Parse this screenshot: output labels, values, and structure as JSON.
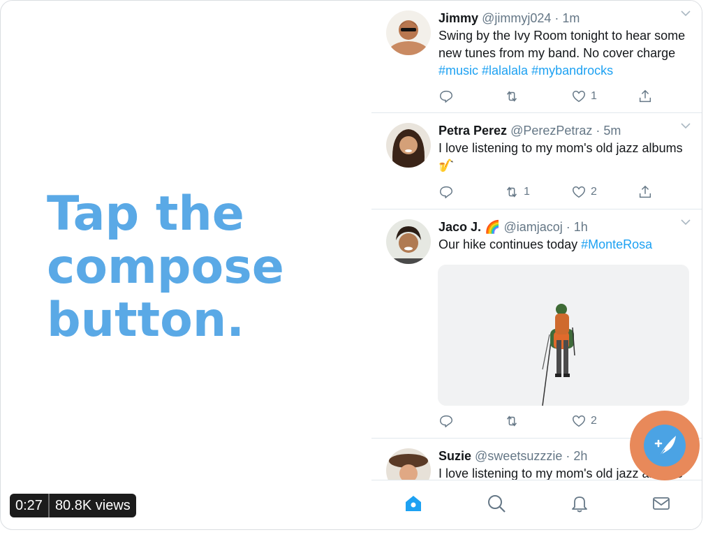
{
  "video": {
    "time": "0:27",
    "views": "80.8K views"
  },
  "headline": {
    "line1": "Tap the",
    "line2": "compose",
    "line3": "button."
  },
  "tweets": [
    {
      "name": "Jimmy",
      "meta": "@jimmyj024 · 1m",
      "text": "Swing by the Ivy Room tonight to hear some new tunes from my band. No cover charge ",
      "hashtags": "#music #lalalala #mybandrocks",
      "counts": {
        "reply": "",
        "retweet": "",
        "like": "1"
      }
    },
    {
      "name": "Petra Perez",
      "meta": "@PerezPetraz · 5m",
      "text": "I love listening to my mom's old jazz albums 🎷",
      "hashtags": "",
      "counts": {
        "reply": "",
        "retweet": "1",
        "like": "2"
      }
    },
    {
      "name": "Jaco J. 🌈",
      "meta": "@iamjacoj · 1h",
      "text": "Our hike continues today ",
      "hashtags": "#MonteRosa",
      "counts": {
        "reply": "",
        "retweet": "",
        "like": "2"
      }
    },
    {
      "name": "Suzie",
      "meta": "@sweetsuzzzie · 2h",
      "text": "I love listening to my mom's old jazz albums",
      "hashtags": "",
      "counts": {
        "reply": "",
        "retweet": "",
        "like": ""
      }
    }
  ],
  "tabs": [
    "home-icon",
    "search-icon",
    "bell-icon",
    "mail-icon"
  ],
  "colors": {
    "accent": "#1da1f2",
    "headline": "#5aa9e6",
    "fab_ring": "#e8895a"
  }
}
